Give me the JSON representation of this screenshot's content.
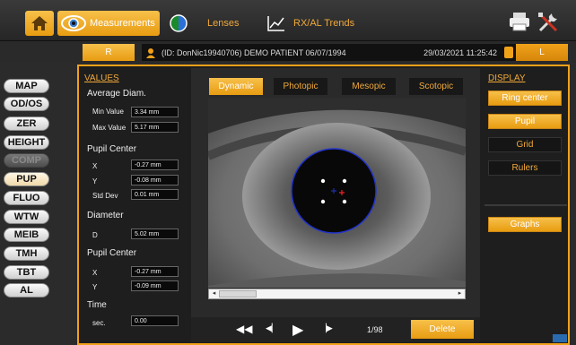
{
  "toolbar": {
    "tabs": [
      {
        "label": "Measurements",
        "active": true
      },
      {
        "label": "Lenses",
        "active": false
      },
      {
        "label": "RX/AL Trends",
        "active": false
      }
    ]
  },
  "patient": {
    "right_eye": "R",
    "left_eye": "L",
    "info": "(ID: DonNic19940706) DEMO PATIENT 06/07/1994",
    "datetime": "29/03/2021 11:25:42"
  },
  "nav": [
    "MAP",
    "OD/OS",
    "ZER",
    "HEIGHT",
    "COMP",
    "PUP",
    "FLUO",
    "WTW",
    "MEIB",
    "TMH",
    "TBT",
    "AL"
  ],
  "values": {
    "title": "VALUES",
    "avg_diam_label": "Average Diam.",
    "min_label": "Min Value",
    "min_value": "3.34 mm",
    "max_label": "Max Value",
    "max_value": "5.17 mm",
    "pupil_center_label": "Pupil Center",
    "pc_x_label": "X",
    "pc_x_value": "-0.27 mm",
    "pc_y_label": "Y",
    "pc_y_value": "-0.08 mm",
    "std_label": "Std Dev",
    "std_value": "0.01 mm",
    "diameter_label": "Diameter",
    "d_label": "D",
    "d_value": "5.02 mm",
    "pupil_center2_label": "Pupil Center",
    "pc2_x_label": "X",
    "pc2_x_value": "-0.27 mm",
    "pc2_y_label": "Y",
    "pc2_y_value": "-0.09 mm",
    "time_label": "Time",
    "sec_label": "sec.",
    "sec_value": "0.00"
  },
  "modes": [
    "Dynamic",
    "Photopic",
    "Mesopic",
    "Scotopic"
  ],
  "playback": {
    "frame": "1/98",
    "delete_label": "Delete"
  },
  "display": {
    "title": "DISPLAY",
    "ring_center": "Ring center",
    "pupil": "Pupil",
    "grid": "Grid",
    "rulers": "Rulers",
    "graphs": "Graphs"
  },
  "colors": {
    "accent": "#f0a11a",
    "pupil_ring": "#2233cc"
  }
}
